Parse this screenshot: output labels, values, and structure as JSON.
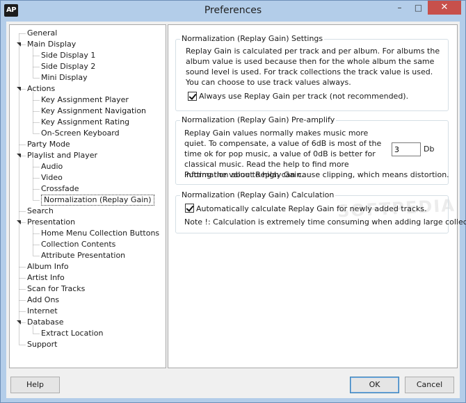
{
  "window": {
    "app_icon_text": "AP",
    "title": "Preferences",
    "minimize_glyph": "–",
    "maximize_glyph": "□",
    "close_glyph": "✕"
  },
  "tree": {
    "items": [
      {
        "label": "General",
        "level": 0,
        "expandable": false
      },
      {
        "label": "Main Display",
        "level": 0,
        "expandable": true
      },
      {
        "label": "Side Display 1",
        "level": 1,
        "expandable": false
      },
      {
        "label": "Side Display 2",
        "level": 1,
        "expandable": false
      },
      {
        "label": "Mini Display",
        "level": 1,
        "expandable": false
      },
      {
        "label": "Actions",
        "level": 0,
        "expandable": true
      },
      {
        "label": "Key Assignment Player",
        "level": 1,
        "expandable": false
      },
      {
        "label": "Key Assignment Navigation",
        "level": 1,
        "expandable": false
      },
      {
        "label": "Key Assignment Rating",
        "level": 1,
        "expandable": false
      },
      {
        "label": "On-Screen Keyboard",
        "level": 1,
        "expandable": false
      },
      {
        "label": "Party Mode",
        "level": 0,
        "expandable": false
      },
      {
        "label": "Playlist and Player",
        "level": 0,
        "expandable": true
      },
      {
        "label": "Audio",
        "level": 1,
        "expandable": false
      },
      {
        "label": "Video",
        "level": 1,
        "expandable": false
      },
      {
        "label": "Crossfade",
        "level": 1,
        "expandable": false
      },
      {
        "label": "Normalization (Replay Gain)",
        "level": 1,
        "expandable": false,
        "selected": true
      },
      {
        "label": "Search",
        "level": 0,
        "expandable": false
      },
      {
        "label": "Presentation",
        "level": 0,
        "expandable": true
      },
      {
        "label": "Home Menu Collection Buttons",
        "level": 1,
        "expandable": false
      },
      {
        "label": "Collection Contents",
        "level": 1,
        "expandable": false
      },
      {
        "label": "Attribute Presentation",
        "level": 1,
        "expandable": false
      },
      {
        "label": "Album Info",
        "level": 0,
        "expandable": false
      },
      {
        "label": "Artist Info",
        "level": 0,
        "expandable": false
      },
      {
        "label": "Scan for Tracks",
        "level": 0,
        "expandable": false
      },
      {
        "label": "Add Ons",
        "level": 0,
        "expandable": false
      },
      {
        "label": "Internet",
        "level": 0,
        "expandable": false
      },
      {
        "label": "Database",
        "level": 0,
        "expandable": true
      },
      {
        "label": "Extract Location",
        "level": 1,
        "expandable": false
      },
      {
        "label": "Support",
        "level": 0,
        "expandable": false
      }
    ]
  },
  "settings": {
    "group1": {
      "title": "Normalization (Replay Gain) Settings",
      "description": "Replay Gain is calculated per track and per album. For albums the album value is used because then for the whole album the same sound level is used. For track collections the track value is used. You can choose to use track values always.",
      "checkbox_label": "Always use Replay Gain per track (not recommended).",
      "checkbox_checked": true
    },
    "group2": {
      "title": "Normalization (Replay Gain) Pre-amplify",
      "description": "Replay Gain values normally makes music more quiet. To compensate, a value of 6dB is most of the time ok for pop music, a value of 0dB is better for classical music. Read the help to find more information about Replay Gain.",
      "input_value": "3",
      "unit_label": "Db",
      "warning": "Putting the value to high can cause clipping, which means distortion."
    },
    "group3": {
      "title": "Normalization (Replay Gain) Calculation",
      "checkbox_label": "Automatically calculate Replay Gain for newly added tracks.",
      "checkbox_checked": true,
      "note": "Note !: Calculation is extremely time consuming when adding large collections."
    }
  },
  "watermark": "SOFTPEDIA",
  "buttons": {
    "help": "Help",
    "ok": "OK",
    "cancel": "Cancel"
  },
  "colors": {
    "titlebar": "#b3cde9",
    "close_button": "#c7504b",
    "panel_background": "#ffffff",
    "dialog_background": "#f0f0f0"
  }
}
